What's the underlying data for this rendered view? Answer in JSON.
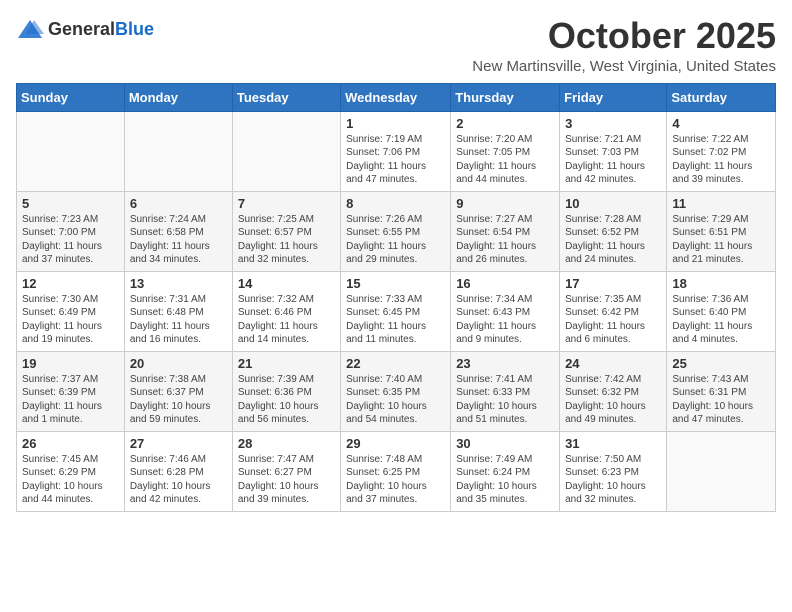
{
  "header": {
    "logo_general": "General",
    "logo_blue": "Blue",
    "title": "October 2025",
    "subtitle": "New Martinsville, West Virginia, United States"
  },
  "weekdays": [
    "Sunday",
    "Monday",
    "Tuesday",
    "Wednesday",
    "Thursday",
    "Friday",
    "Saturday"
  ],
  "weeks": [
    {
      "days": [
        {
          "num": "",
          "info": ""
        },
        {
          "num": "",
          "info": ""
        },
        {
          "num": "",
          "info": ""
        },
        {
          "num": "1",
          "info": "Sunrise: 7:19 AM\nSunset: 7:06 PM\nDaylight: 11 hours and 47 minutes."
        },
        {
          "num": "2",
          "info": "Sunrise: 7:20 AM\nSunset: 7:05 PM\nDaylight: 11 hours and 44 minutes."
        },
        {
          "num": "3",
          "info": "Sunrise: 7:21 AM\nSunset: 7:03 PM\nDaylight: 11 hours and 42 minutes."
        },
        {
          "num": "4",
          "info": "Sunrise: 7:22 AM\nSunset: 7:02 PM\nDaylight: 11 hours and 39 minutes."
        }
      ]
    },
    {
      "days": [
        {
          "num": "5",
          "info": "Sunrise: 7:23 AM\nSunset: 7:00 PM\nDaylight: 11 hours and 37 minutes."
        },
        {
          "num": "6",
          "info": "Sunrise: 7:24 AM\nSunset: 6:58 PM\nDaylight: 11 hours and 34 minutes."
        },
        {
          "num": "7",
          "info": "Sunrise: 7:25 AM\nSunset: 6:57 PM\nDaylight: 11 hours and 32 minutes."
        },
        {
          "num": "8",
          "info": "Sunrise: 7:26 AM\nSunset: 6:55 PM\nDaylight: 11 hours and 29 minutes."
        },
        {
          "num": "9",
          "info": "Sunrise: 7:27 AM\nSunset: 6:54 PM\nDaylight: 11 hours and 26 minutes."
        },
        {
          "num": "10",
          "info": "Sunrise: 7:28 AM\nSunset: 6:52 PM\nDaylight: 11 hours and 24 minutes."
        },
        {
          "num": "11",
          "info": "Sunrise: 7:29 AM\nSunset: 6:51 PM\nDaylight: 11 hours and 21 minutes."
        }
      ]
    },
    {
      "days": [
        {
          "num": "12",
          "info": "Sunrise: 7:30 AM\nSunset: 6:49 PM\nDaylight: 11 hours and 19 minutes."
        },
        {
          "num": "13",
          "info": "Sunrise: 7:31 AM\nSunset: 6:48 PM\nDaylight: 11 hours and 16 minutes."
        },
        {
          "num": "14",
          "info": "Sunrise: 7:32 AM\nSunset: 6:46 PM\nDaylight: 11 hours and 14 minutes."
        },
        {
          "num": "15",
          "info": "Sunrise: 7:33 AM\nSunset: 6:45 PM\nDaylight: 11 hours and 11 minutes."
        },
        {
          "num": "16",
          "info": "Sunrise: 7:34 AM\nSunset: 6:43 PM\nDaylight: 11 hours and 9 minutes."
        },
        {
          "num": "17",
          "info": "Sunrise: 7:35 AM\nSunset: 6:42 PM\nDaylight: 11 hours and 6 minutes."
        },
        {
          "num": "18",
          "info": "Sunrise: 7:36 AM\nSunset: 6:40 PM\nDaylight: 11 hours and 4 minutes."
        }
      ]
    },
    {
      "days": [
        {
          "num": "19",
          "info": "Sunrise: 7:37 AM\nSunset: 6:39 PM\nDaylight: 11 hours and 1 minute."
        },
        {
          "num": "20",
          "info": "Sunrise: 7:38 AM\nSunset: 6:37 PM\nDaylight: 10 hours and 59 minutes."
        },
        {
          "num": "21",
          "info": "Sunrise: 7:39 AM\nSunset: 6:36 PM\nDaylight: 10 hours and 56 minutes."
        },
        {
          "num": "22",
          "info": "Sunrise: 7:40 AM\nSunset: 6:35 PM\nDaylight: 10 hours and 54 minutes."
        },
        {
          "num": "23",
          "info": "Sunrise: 7:41 AM\nSunset: 6:33 PM\nDaylight: 10 hours and 51 minutes."
        },
        {
          "num": "24",
          "info": "Sunrise: 7:42 AM\nSunset: 6:32 PM\nDaylight: 10 hours and 49 minutes."
        },
        {
          "num": "25",
          "info": "Sunrise: 7:43 AM\nSunset: 6:31 PM\nDaylight: 10 hours and 47 minutes."
        }
      ]
    },
    {
      "days": [
        {
          "num": "26",
          "info": "Sunrise: 7:45 AM\nSunset: 6:29 PM\nDaylight: 10 hours and 44 minutes."
        },
        {
          "num": "27",
          "info": "Sunrise: 7:46 AM\nSunset: 6:28 PM\nDaylight: 10 hours and 42 minutes."
        },
        {
          "num": "28",
          "info": "Sunrise: 7:47 AM\nSunset: 6:27 PM\nDaylight: 10 hours and 39 minutes."
        },
        {
          "num": "29",
          "info": "Sunrise: 7:48 AM\nSunset: 6:25 PM\nDaylight: 10 hours and 37 minutes."
        },
        {
          "num": "30",
          "info": "Sunrise: 7:49 AM\nSunset: 6:24 PM\nDaylight: 10 hours and 35 minutes."
        },
        {
          "num": "31",
          "info": "Sunrise: 7:50 AM\nSunset: 6:23 PM\nDaylight: 10 hours and 32 minutes."
        },
        {
          "num": "",
          "info": ""
        }
      ]
    }
  ]
}
